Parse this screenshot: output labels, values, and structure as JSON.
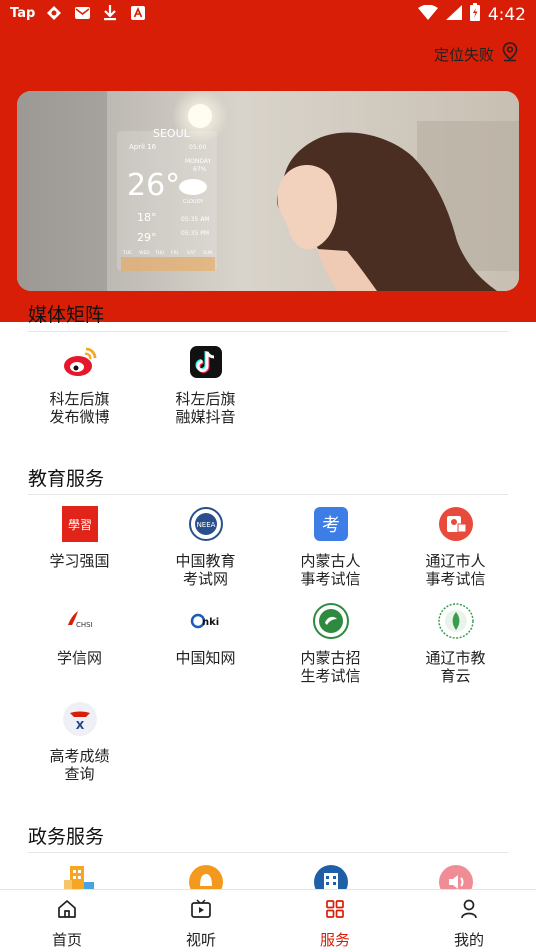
{
  "status": {
    "carrier": "Tap",
    "time": "4:42"
  },
  "location": {
    "label": "定位失败"
  },
  "banner": {
    "city": "SEOUL",
    "date": "April 16",
    "temp": "26°",
    "condition": "CLOUDY",
    "low": "18°",
    "high": "29°",
    "sunrise": "05:35 AM",
    "sunset": "05:35 PM",
    "day": "MONDAY",
    "humidity": "67%",
    "time_small": "05:00",
    "forecast_days": [
      "TUE",
      "WED",
      "THU",
      "FRI",
      "SAT",
      "SUN"
    ]
  },
  "media": {
    "title": "媒体矩阵",
    "items": [
      {
        "label1": "科左后旗",
        "label2": "发布微博",
        "icon": "weibo-icon"
      },
      {
        "label1": "科左后旗",
        "label2": "融媒抖音",
        "icon": "douyin-icon"
      }
    ]
  },
  "education": {
    "title": "教育服务",
    "items": [
      {
        "label1": "学习强国",
        "label2": "",
        "icon": "xuexi-qiangguo-icon"
      },
      {
        "label1": "中国教育",
        "label2": "考试网",
        "icon": "neea-icon"
      },
      {
        "label1": "内蒙古人",
        "label2": "事考试信",
        "icon": "kao-icon"
      },
      {
        "label1": "通辽市人",
        "label2": "事考试信",
        "icon": "tongliao-exam-icon"
      },
      {
        "label1": "学信网",
        "label2": "",
        "icon": "chsi-icon"
      },
      {
        "label1": "中国知网",
        "label2": "",
        "icon": "cnki-icon"
      },
      {
        "label1": "内蒙古招",
        "label2": "生考试信",
        "icon": "nm-admission-icon"
      },
      {
        "label1": "通辽市教",
        "label2": "育云",
        "icon": "tongliao-edu-cloud-icon"
      },
      {
        "label1": "高考成绩",
        "label2": "查询",
        "icon": "gaokao-score-icon"
      }
    ]
  },
  "government": {
    "title": "政务服务"
  },
  "tabs": [
    {
      "label": "首页",
      "icon": "home-icon"
    },
    {
      "label": "视听",
      "icon": "video-icon"
    },
    {
      "label": "服务",
      "icon": "grid-icon"
    },
    {
      "label": "我的",
      "icon": "person-icon"
    }
  ],
  "colors": {
    "brand_red": "#d81e06",
    "active_tab": "#d81e06"
  }
}
